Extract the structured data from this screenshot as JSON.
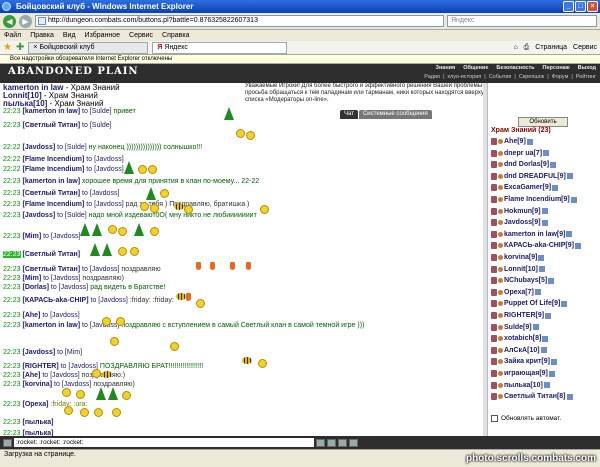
{
  "window": {
    "title": "Бойцовский клуб - Windows Internet Explorer"
  },
  "browser": {
    "url": "http://dungeon.combats.com/buttons.pl?battle=0.876325822607313",
    "search_placeholder": "Яндекс",
    "menu": [
      "Файл",
      "Правка",
      "Вид",
      "Избранное",
      "Сервис",
      "Справка"
    ],
    "tabs": [
      "Бойцовский клуб",
      "Яндекс"
    ],
    "toolbar_right": [
      "Страница",
      "Сервис"
    ],
    "infobar": "Все надстройки обозревателя Internet Explorer отключены"
  },
  "game": {
    "logo": "ABANDONED PLAIN",
    "menu": [
      "Знания",
      "Общение",
      "Безопасность",
      "Персонаж",
      "Выход"
    ],
    "submenu": [
      "Радио",
      "клуо-история",
      "События",
      "Скрепшок",
      "Форум",
      "Рейтинг"
    ],
    "notice": "Уважаемые Игроки! Для более быстрого и эффективного решения Вашей проблемы просьба обращаться к тем паладинам или тарманам, ники которых находятся вверху списка «Модераторы on-line».",
    "chat_tabs": [
      "Чат",
      "Системные сообщения"
    ]
  },
  "chat": {
    "top": [
      {
        "nick": "kamerton in law",
        "text": "- Храм Знаний"
      },
      {
        "nick": "Lonnit[10]",
        "text": "- Храм Знаний"
      },
      {
        "nick": "пылька[10]",
        "text": "- Храм Знаний"
      }
    ],
    "lines": [
      {
        "t": "22:23",
        "hl": false,
        "nick": "[kamerton in law]",
        "to": "to [Sulde]",
        "msg": "привет",
        "c": "g"
      },
      {
        "t": "22:23",
        "hl": false,
        "nick": "[Светлый Титан]",
        "to": "to [Sulde]",
        "msg": "",
        "c": "g"
      },
      {
        "t": "22:22",
        "hl": false,
        "nick": "[Javdoss]",
        "to": "to [Sulde]",
        "msg": "ну наконец ))))))))))))))) солнышко!!!",
        "c": "g"
      },
      {
        "t": "22:22",
        "hl": false,
        "nick": "[Flame Incendium]",
        "to": "to [Javdoss]",
        "msg": "",
        "c": "g"
      },
      {
        "t": "22:22",
        "hl": false,
        "nick": "[Flame Incendium]",
        "to": "to [Javdoss]",
        "msg": "",
        "c": "g"
      },
      {
        "t": "22:23",
        "hl": false,
        "nick": "[kamerton in law]",
        "to": "",
        "msg": "хорошее время для принятия в клан по-моему... 22-22",
        "c": "g"
      },
      {
        "t": "22:23",
        "hl": false,
        "nick": "[Светлый Титан]",
        "to": "to [Javdoss]",
        "msg": "",
        "c": "g"
      },
      {
        "t": "22:23",
        "hl": false,
        "nick": "[Flame Incendium]",
        "to": "to [Javdoss]",
        "msg": "рад за тебя ) Поздравляю, братишка )",
        "c": "b"
      },
      {
        "t": "22:23",
        "hl": false,
        "nick": "[Javdoss]",
        "to": "to [Sulde]",
        "msg": "надо мной издевают0О( мну никто не любииииииит",
        "c": "g"
      },
      {
        "t": "22:23",
        "hl": false,
        "nick": "[Mim]",
        "to": "to [Javdoss]",
        "msg": "",
        "c": "g"
      },
      {
        "t": "22:23",
        "hl": true,
        "nick": "[Светлый Титан]",
        "to": "",
        "msg": "",
        "c": "g"
      },
      {
        "t": "22:23",
        "hl": false,
        "nick": "[Светлый Титан]",
        "to": "to [Javdoss]",
        "msg": "поздравляю",
        "c": "b"
      },
      {
        "t": "22:23",
        "hl": false,
        "nick": "[Mim]",
        "to": "to [Javdoss]",
        "msg": "поздравляю)",
        "c": "b"
      },
      {
        "t": "22:23",
        "hl": false,
        "nick": "[Dorlas]",
        "to": "to [Javdoss]",
        "msg": "рад видеть в Братстве!",
        "c": "g"
      },
      {
        "t": "22:23",
        "hl": false,
        "nick": "[КАРАСЬ-aka-CHIP]",
        "to": "to [Javdoss]",
        "msg": ":friday: :friday:",
        "c": "b"
      },
      {
        "t": "22:23",
        "hl": false,
        "nick": "[Ahe]",
        "to": "to [Javdoss]",
        "msg": "",
        "c": "g"
      },
      {
        "t": "22:23",
        "hl": false,
        "nick": "[kamerton in law]",
        "to": "to [Javdoss]",
        "msg": "поздравляю с вступлением в самый Светлый клан в самой темной игре )))",
        "c": "g"
      },
      {
        "t": "22:23",
        "hl": false,
        "nick": "[Javdoss]",
        "to": "to [Mim]",
        "msg": "",
        "c": "g"
      },
      {
        "t": "22:23",
        "hl": false,
        "nick": "[RIGHTER]",
        "to": "to [Javdoss]",
        "msg": "ПОЗДРАВЛЯЮ БРАТ!!!!!!!!!!!!!!!!!!",
        "c": "g"
      },
      {
        "t": "22:23",
        "hl": false,
        "nick": "[Ahe]",
        "to": "to [Javdoss]",
        "msg": "поздравляю:)",
        "c": "b"
      },
      {
        "t": "22:23",
        "hl": false,
        "nick": "[korvina]",
        "to": "to [Javdoss]",
        "msg": "поздравляю)",
        "c": "b"
      },
      {
        "t": "22:23",
        "hl": false,
        "nick": "[Ореха]",
        "to": "",
        "msg": ":friday: :ura:",
        "c": "y"
      },
      {
        "t": "22:23",
        "hl": false,
        "nick": "[пылька]",
        "to": "",
        "msg": "",
        "c": "g"
      },
      {
        "t": "22:23",
        "hl": false,
        "nick": "[пылька]",
        "to": "",
        "msg": "",
        "c": "g"
      }
    ],
    "input_value": ":rocket: :rocket: :rocket:"
  },
  "room": {
    "refresh_label": "Обновить",
    "title": "Храм Знаний (23)",
    "players": [
      "Ahe[9]",
      "dnepr ua[7]",
      "dnd Dorlas[9]",
      "dnd DREADFUL[9]",
      "ExcaGamer[9]",
      "Flame Incendium[9]",
      "Hokmun[9]",
      "Javdoss[9]",
      "kamerton in law[9]",
      "КАРАСЬ-aka-CHIP[9]",
      "korvina[9]",
      "Lonnit[10]",
      "NChubays[5]",
      "Ореха[7]",
      "Puppet Of Life[9]",
      "RIGHTER[9]",
      "Sulde[9]",
      "xotabich[8]",
      "АлСкА[10]",
      "Зайка крит[9]",
      "играющая[9]",
      "пылька[10]",
      "Светлый Титан[8]"
    ],
    "auto_label": "Обновлять автомат."
  },
  "status": {
    "text": "Загрузка на странице.",
    "watermark": "photo.scrolls.combats.com"
  }
}
